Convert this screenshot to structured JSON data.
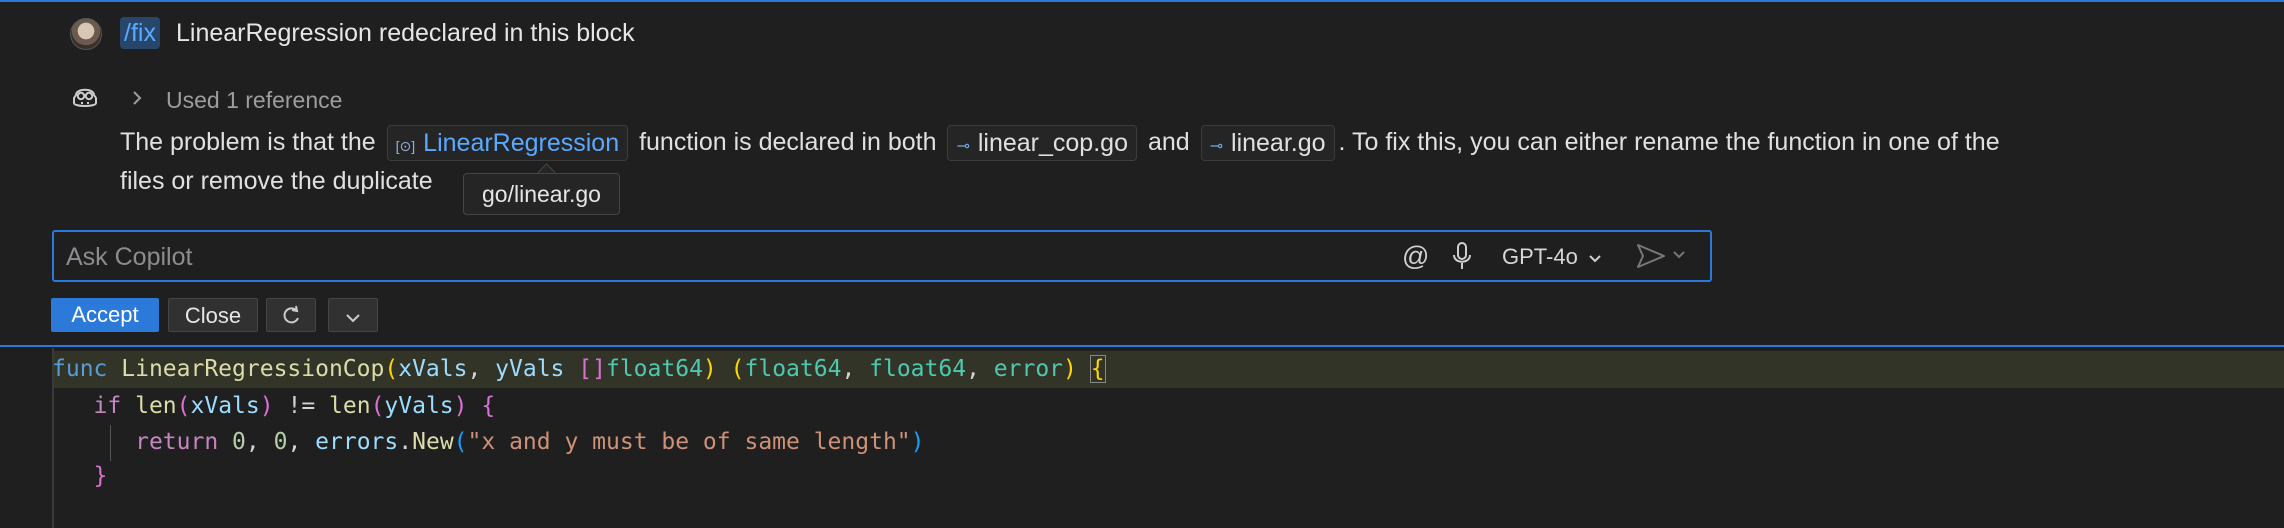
{
  "request": {
    "command": "/fix",
    "text": "LinearRegression redeclared in this block"
  },
  "response": {
    "references_label": "Used 1 reference",
    "intro": "The problem is that the",
    "symbol_chip": "LinearRegression",
    "mid1": "function is declared in both",
    "file_chip_1": "linear_cop.go",
    "mid2": "and",
    "file_chip_2": "linear.go",
    "tail": ". To fix this, you can either rename the function in one of the",
    "line2": "files or remove the duplicate"
  },
  "tooltip": {
    "text": "go/linear.go"
  },
  "input": {
    "placeholder": "Ask Copilot",
    "at_symbol": "@",
    "model": "GPT-4o"
  },
  "actions": {
    "accept": "Accept",
    "close": "Close"
  },
  "code": {
    "line1": {
      "func": "func",
      "name": "LinearRegressionCop",
      "p_open": "(",
      "x": "xVals",
      "comma1": ", ",
      "y": "yVals",
      "brackets": "[]",
      "type1": "float64",
      "p_close": ")",
      "r_open": "(",
      "rt1": "float64",
      "rt2": "float64",
      "rt3": "error",
      "r_close": ")",
      "brace": "{"
    },
    "line2": {
      "if": "if",
      "len1": "len",
      "x": "xVals",
      "neq": " != ",
      "len2": "len",
      "y": "yVals",
      "brace": "{"
    },
    "line3": {
      "return": "return",
      "n1": "0",
      "n2": "0",
      "errors": "errors",
      "new": "New",
      "msg": "\"x and y must be of same length\""
    },
    "line4": {
      "brace": "}"
    }
  },
  "colors": {
    "accent": "#2b79d8",
    "background": "#1f1f1f"
  },
  "icons": [
    "user-avatar-icon",
    "copilot-icon",
    "chevron-right-icon",
    "symbol-icon",
    "link-icon",
    "at-icon",
    "microphone-icon",
    "chevron-down-icon",
    "send-icon",
    "refresh-icon"
  ]
}
